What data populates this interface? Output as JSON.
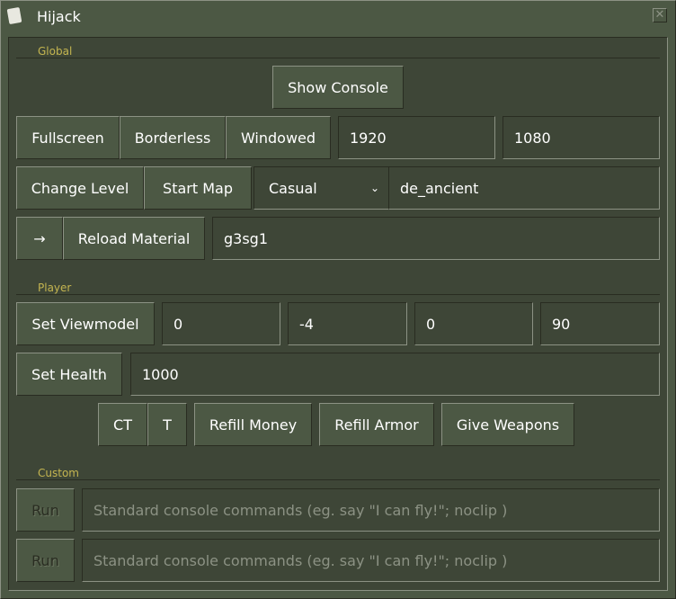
{
  "window": {
    "title": "Hijack",
    "close_icon": "close-icon",
    "app_icon": "document-icon"
  },
  "colors": {
    "background": "#4c5844",
    "panel": "#3e4637",
    "section_label": "#c4b550",
    "border_light": "#8c9284",
    "border_dark": "#292c21"
  },
  "global": {
    "label": "Global",
    "show_console": "Show Console",
    "fullscreen": "Fullscreen",
    "borderless": "Borderless",
    "windowed": "Windowed",
    "width": "1920",
    "height": "1080",
    "change_level": "Change Level",
    "start_map": "Start Map",
    "mode_selected": "Casual",
    "map": "de_ancient",
    "arrow": "→",
    "reload_material": "Reload Material",
    "material": "g3sg1"
  },
  "player": {
    "label": "Player",
    "set_viewmodel": "Set Viewmodel",
    "viewmodel": [
      "0",
      "-4",
      "0",
      "90"
    ],
    "set_health": "Set Health",
    "health": "1000",
    "ct": "CT",
    "t": "T",
    "refill_money": "Refill Money",
    "refill_armor": "Refill Armor",
    "give_weapons": "Give Weapons"
  },
  "custom": {
    "label": "Custom",
    "rows": [
      {
        "run": "Run",
        "placeholder": "Standard console commands (eg. say \"I can fly!\"; noclip )"
      },
      {
        "run": "Run",
        "placeholder": "Standard console commands (eg. say \"I can fly!\"; noclip )"
      }
    ]
  }
}
